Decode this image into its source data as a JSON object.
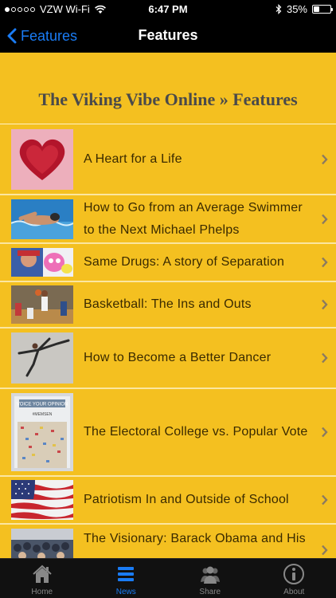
{
  "status": {
    "carrier": "VZW Wi-Fi",
    "time": "6:47 PM",
    "battery": "35%",
    "battery_level": 0.35
  },
  "nav": {
    "back_label": "Features",
    "title": "Features"
  },
  "page": {
    "title": "The Viking Vibe Online » Features"
  },
  "articles": [
    {
      "title": "A Heart for a Life"
    },
    {
      "title": "How to Go from an Average Swimmer to the Next Michael Phelps"
    },
    {
      "title": "Same Drugs: A story of Separation"
    },
    {
      "title": "Basketball: The Ins and Outs"
    },
    {
      "title": "How to Become a Better Dancer"
    },
    {
      "title": "The Electoral College vs. Popular Vote"
    },
    {
      "title": "Patriotism In and Outside of School"
    },
    {
      "title": "The Visionary: Barack Obama and His"
    }
  ],
  "tabs": [
    {
      "label": "Home",
      "icon": "home-icon"
    },
    {
      "label": "News",
      "icon": "list-icon"
    },
    {
      "label": "Share",
      "icon": "people-icon"
    },
    {
      "label": "About",
      "icon": "info-icon"
    }
  ],
  "colors": {
    "accent": "#1a7cf5",
    "content_bg": "#f4c020"
  },
  "thumb_texts": {
    "voice_sign": "VOICE YOUR OPINION",
    "voice_tag": "#MEMSEN"
  }
}
